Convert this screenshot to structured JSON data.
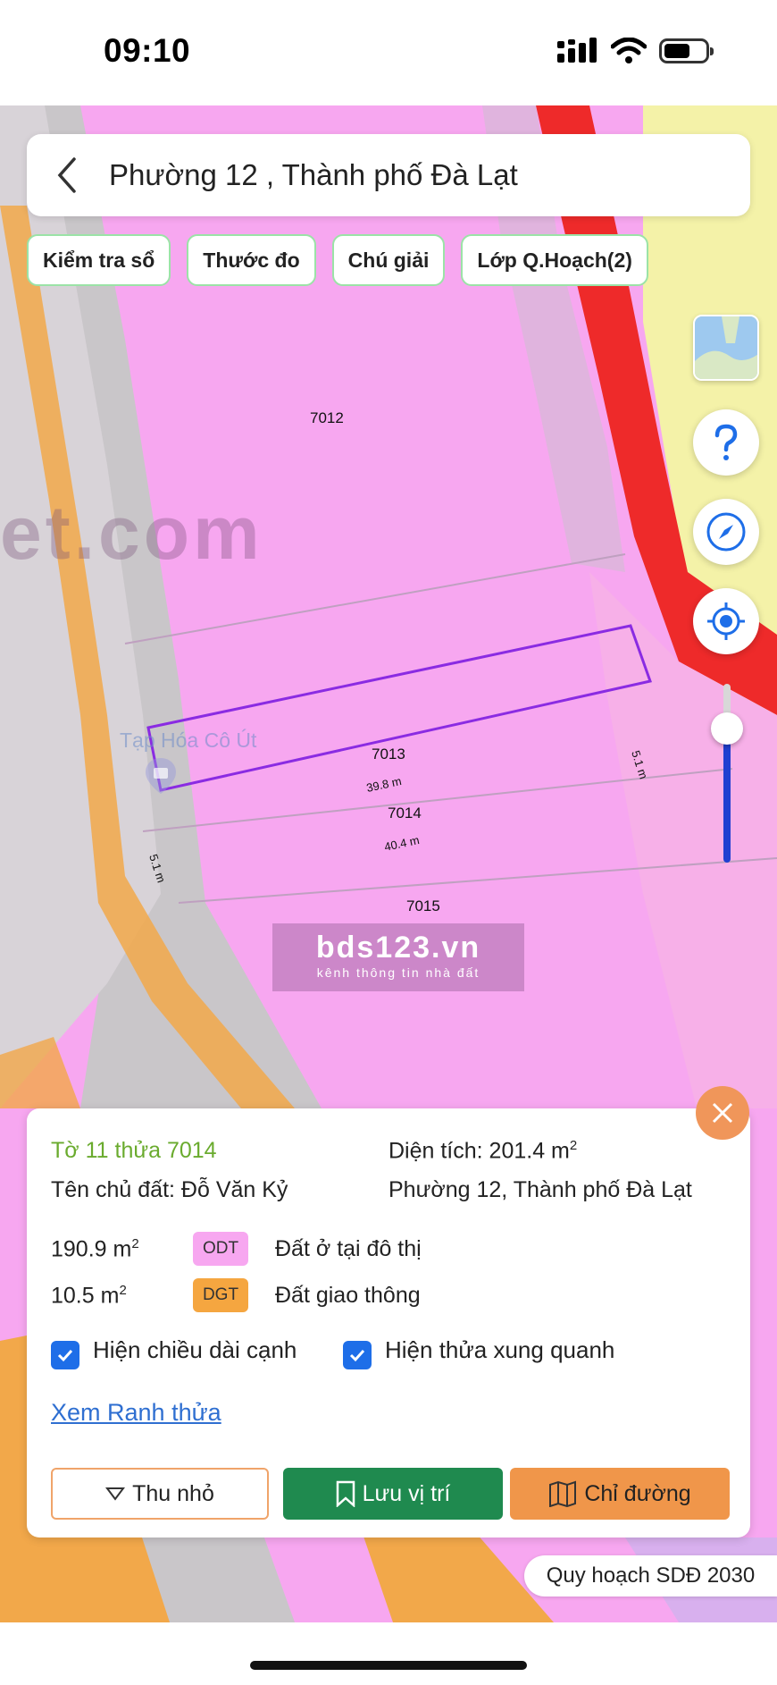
{
  "status_bar": {
    "time": "09:10",
    "battery_level": 0.6
  },
  "header": {
    "title": "Phường 12 , Thành phố Đà Lạt"
  },
  "chips": [
    "Kiểm tra sổ",
    "Thước đo",
    "Chú giải",
    "Lớp Q.Hoạch(2)"
  ],
  "map": {
    "parcel_labels": [
      "7012",
      "7013",
      "7014",
      "7015"
    ],
    "edge_labels": [
      "39.8 m",
      "40.4 m",
      "5.1 m",
      "5.1 m"
    ],
    "poi_name": "Tạp Hóa Cô Út",
    "watermark_faded": "et.com",
    "watermark_title": "bds123.vn",
    "watermark_subtitle": "kênh thông tin nhà đất",
    "zoom_level": 0.75
  },
  "panel": {
    "sheet_parcel": "Tờ 11 thửa 7014",
    "area_label": "Diện tích: 201.4 m",
    "area_sup": "2",
    "owner": "Tên chủ đất: Đỗ Văn Kỷ",
    "location": "Phường 12, Thành phố Đà Lạt",
    "land_uses": [
      {
        "area": "190.9 m",
        "sup": "2",
        "code": "ODT",
        "name": "Đất ở tại đô thị",
        "color": "#f7a7f0"
      },
      {
        "area": "10.5 m",
        "sup": "2",
        "code": "DGT",
        "name": "Đất giao thông",
        "color": "#f5a640"
      }
    ],
    "checkbox_edges": "Hiện chiều dài cạnh",
    "checkbox_neighbors": "Hiện thửa xung quanh",
    "link_boundary": "Xem Ranh thửa",
    "btn_collapse": "Thu nhỏ",
    "btn_save": "Lưu vị trí",
    "btn_directions": "Chỉ đường"
  },
  "plan_label": "Quy hoạch SDĐ 2030",
  "colors": {
    "accent_green": "#1f8a4f",
    "accent_orange": "#f0964a",
    "parcel_outline": "#8a2be2"
  }
}
